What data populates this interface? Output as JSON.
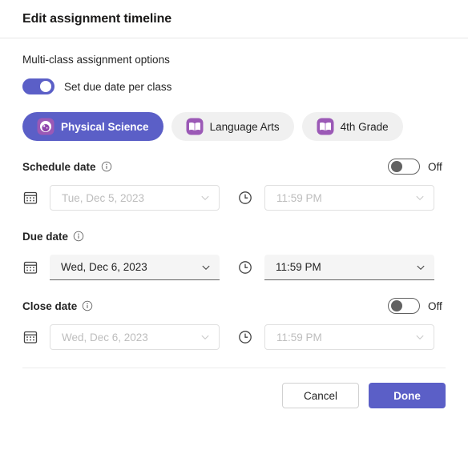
{
  "header": {
    "title": "Edit assignment timeline"
  },
  "multiclass": {
    "section_label": "Multi-class assignment options",
    "toggle": {
      "state": "on",
      "label": "Set due date per class"
    }
  },
  "classes": [
    {
      "name": "Physical Science",
      "icon": "science-beaker-avatar-icon",
      "selected": true
    },
    {
      "name": "Language Arts",
      "icon": "open-book-avatar-icon",
      "selected": false
    },
    {
      "name": "4th Grade",
      "icon": "open-book-avatar-icon",
      "selected": false
    }
  ],
  "sections": [
    {
      "key": "schedule",
      "label": "Schedule date",
      "info_icon": "info-icon",
      "has_toggle": true,
      "toggle_state": "off",
      "toggle_label": "Off",
      "enabled": false,
      "date_icon": "calendar-icon",
      "date_value": "Tue, Dec 5, 2023",
      "time_icon": "clock-icon",
      "time_value": "11:59 PM"
    },
    {
      "key": "due",
      "label": "Due date",
      "info_icon": "info-icon",
      "has_toggle": false,
      "toggle_state": "",
      "toggle_label": "",
      "enabled": true,
      "date_icon": "calendar-icon",
      "date_value": "Wed, Dec 6, 2023",
      "time_icon": "clock-icon",
      "time_value": "11:59 PM"
    },
    {
      "key": "close",
      "label": "Close date",
      "info_icon": "info-icon",
      "has_toggle": true,
      "toggle_state": "off",
      "toggle_label": "Off",
      "enabled": false,
      "date_icon": "calendar-icon",
      "date_value": "Wed, Dec 6, 2023",
      "time_icon": "clock-icon",
      "time_value": "11:59 PM"
    }
  ],
  "footer": {
    "cancel_label": "Cancel",
    "done_label": "Done"
  },
  "colors": {
    "accent": "#5b5fc7",
    "pill_unselected": "#f0f0f0",
    "field_enabled_bg": "#f5f5f5",
    "disabled_text": "#bdbdbd",
    "divider": "#e6e6e6",
    "avatar_purple": "#9b59b6"
  }
}
